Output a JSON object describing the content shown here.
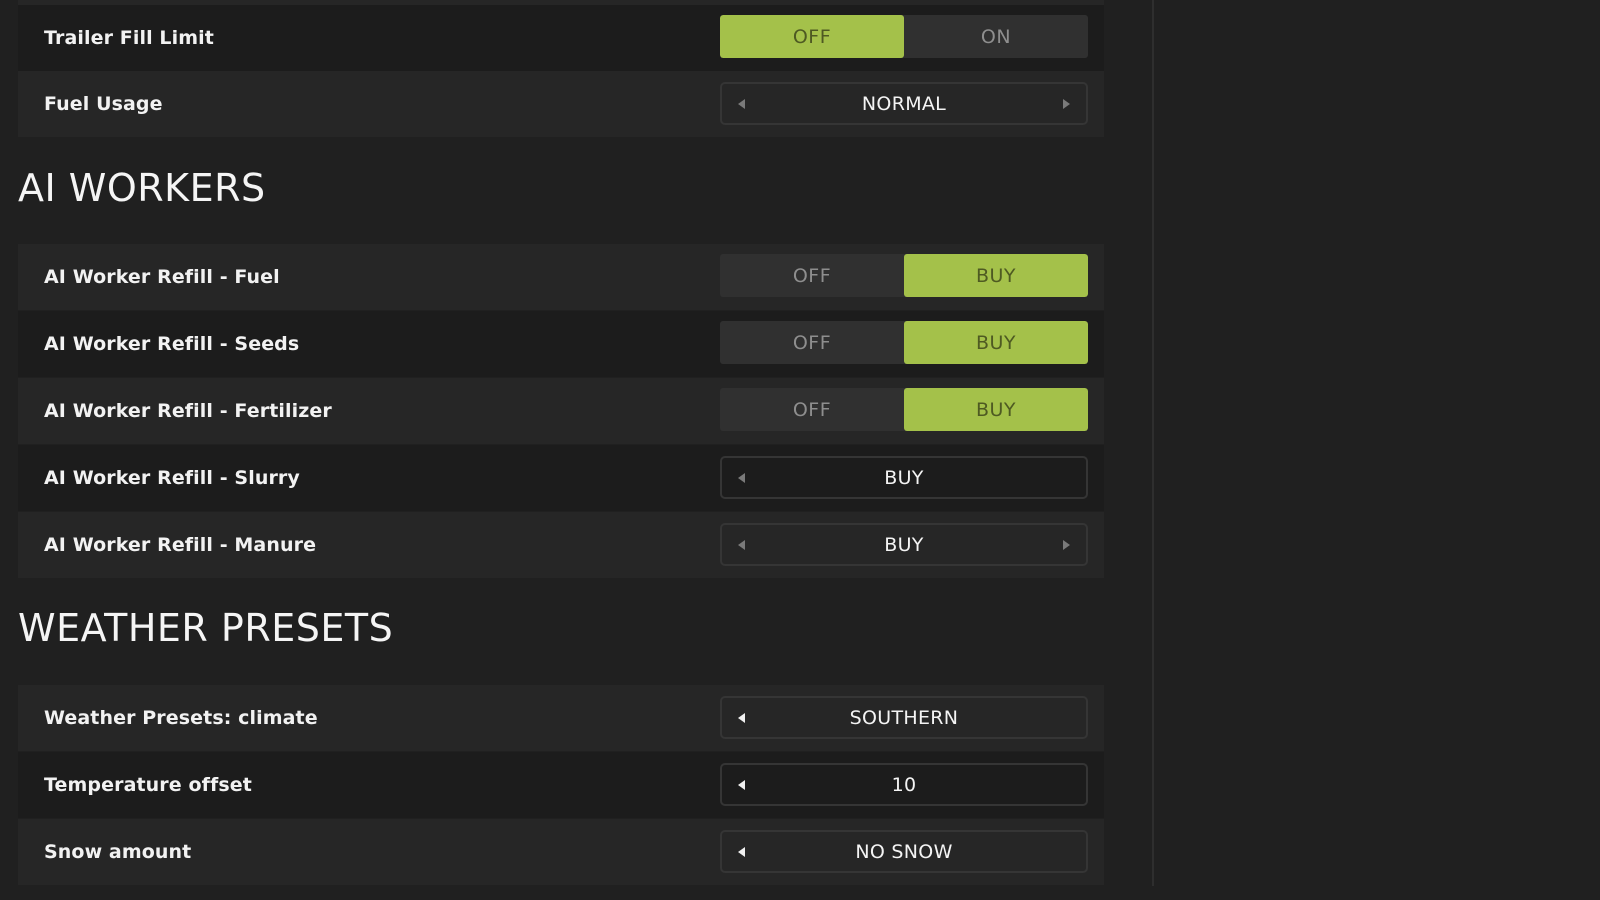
{
  "general": {
    "trailer_fill_limit": {
      "label": "Trailer Fill Limit",
      "off": "OFF",
      "on": "ON"
    },
    "fuel_usage": {
      "label": "Fuel Usage",
      "value": "NORMAL"
    }
  },
  "ai_workers": {
    "heading": "AI WORKERS",
    "refill_fuel": {
      "label": "AI Worker Refill - Fuel",
      "off": "OFF",
      "on": "BUY"
    },
    "refill_seeds": {
      "label": "AI Worker Refill - Seeds",
      "off": "OFF",
      "on": "BUY"
    },
    "refill_fertilizer": {
      "label": "AI Worker Refill - Fertilizer",
      "off": "OFF",
      "on": "BUY"
    },
    "refill_slurry": {
      "label": "AI Worker Refill - Slurry",
      "value": "BUY"
    },
    "refill_manure": {
      "label": "AI Worker Refill - Manure",
      "value": "BUY"
    }
  },
  "weather_presets": {
    "heading": "WEATHER PRESETS",
    "climate": {
      "label": "Weather Presets: climate",
      "value": "SOUTHERN"
    },
    "temperature_offset": {
      "label": "Temperature offset",
      "value": "10"
    },
    "snow_amount": {
      "label": "Snow amount",
      "value": "NO SNOW"
    }
  },
  "colors": {
    "accent": "#a4c14a",
    "background": "#202020"
  }
}
